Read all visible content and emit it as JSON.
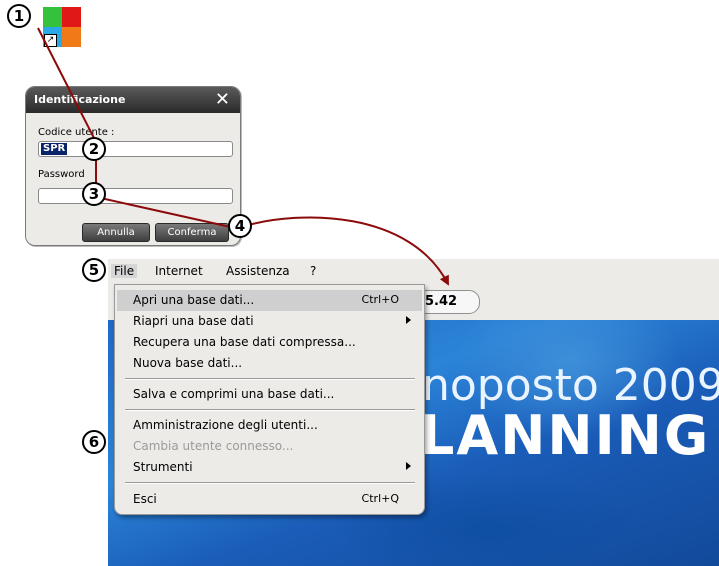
{
  "app_icon": {
    "name": "app-shortcut-icon",
    "shortcut_glyph": "↗"
  },
  "login": {
    "title": "Identificazione",
    "user_label": "Codice utente :",
    "user_value": "SPR",
    "password_label": "Password",
    "password_value": "",
    "cancel_label": "Annulla",
    "confirm_label": "Conferma"
  },
  "menubar": {
    "items": [
      "File",
      "Internet",
      "Assistenza",
      "?"
    ]
  },
  "background": {
    "version": "5.42",
    "brand_line1": "noposto 2009",
    "brand_line2": "LANNING"
  },
  "file_menu": {
    "items": [
      {
        "label": "Apri una base dati...",
        "shortcut": "Ctrl+O"
      },
      {
        "label": "Riapri una base dati",
        "shortcut": ""
      },
      {
        "label": "Recupera una base dati compressa...",
        "shortcut": ""
      },
      {
        "label": "Nuova base dati...",
        "shortcut": ""
      },
      {
        "label": "Salva e comprimi una base dati...",
        "shortcut": ""
      },
      {
        "label": "Amministrazione degli utenti...",
        "shortcut": ""
      },
      {
        "label": "Cambia utente connesso...",
        "shortcut": ""
      },
      {
        "label": "Strumenti",
        "shortcut": ""
      },
      {
        "label": "Esci",
        "shortcut": "Ctrl+Q"
      }
    ]
  },
  "callouts": [
    "1",
    "2",
    "3",
    "4",
    "5",
    "6"
  ],
  "colors": {
    "arrow": "#8b0a0a",
    "selection": "#0a246a",
    "splash_blue": "#1e68c4"
  }
}
